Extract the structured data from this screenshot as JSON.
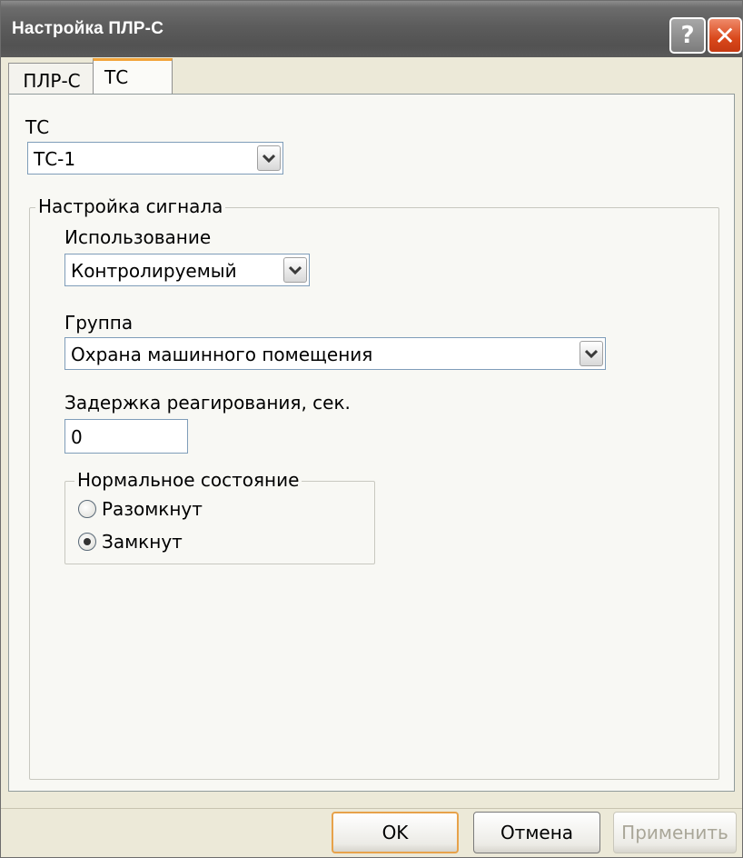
{
  "window": {
    "title": "Настройка ПЛР-С",
    "help_label": "?",
    "close_label": "✕"
  },
  "tabs": [
    {
      "label": "ПЛР-С",
      "active": false
    },
    {
      "label": "ТС",
      "active": true
    }
  ],
  "tc": {
    "label": "ТС",
    "selected": "ТС-1"
  },
  "signal_settings": {
    "legend": "Настройка сигнала",
    "usage": {
      "label": "Использование",
      "selected": "Контролируемый"
    },
    "group": {
      "label": "Группа",
      "selected": "Охрана машинного помещения"
    },
    "delay": {
      "label": "Задержка реагирования, сек.",
      "value": "0"
    },
    "normal_state": {
      "legend": "Нормальное состояние",
      "options": [
        {
          "label": "Разомкнут",
          "checked": false
        },
        {
          "label": "Замкнут",
          "checked": true
        }
      ]
    }
  },
  "buttons": {
    "ok": "OK",
    "cancel": "Отмена",
    "apply": "Применить"
  },
  "colors": {
    "title_bar": "#5c5c5c",
    "close_button": "#d9481b",
    "active_tab_accent": "#f2a43a",
    "default_button_border": "#e7a24a",
    "disabled_text": "#a9a698"
  },
  "icons": {
    "dropdown": "chevron-down-icon",
    "help": "help-icon",
    "close": "close-icon"
  }
}
